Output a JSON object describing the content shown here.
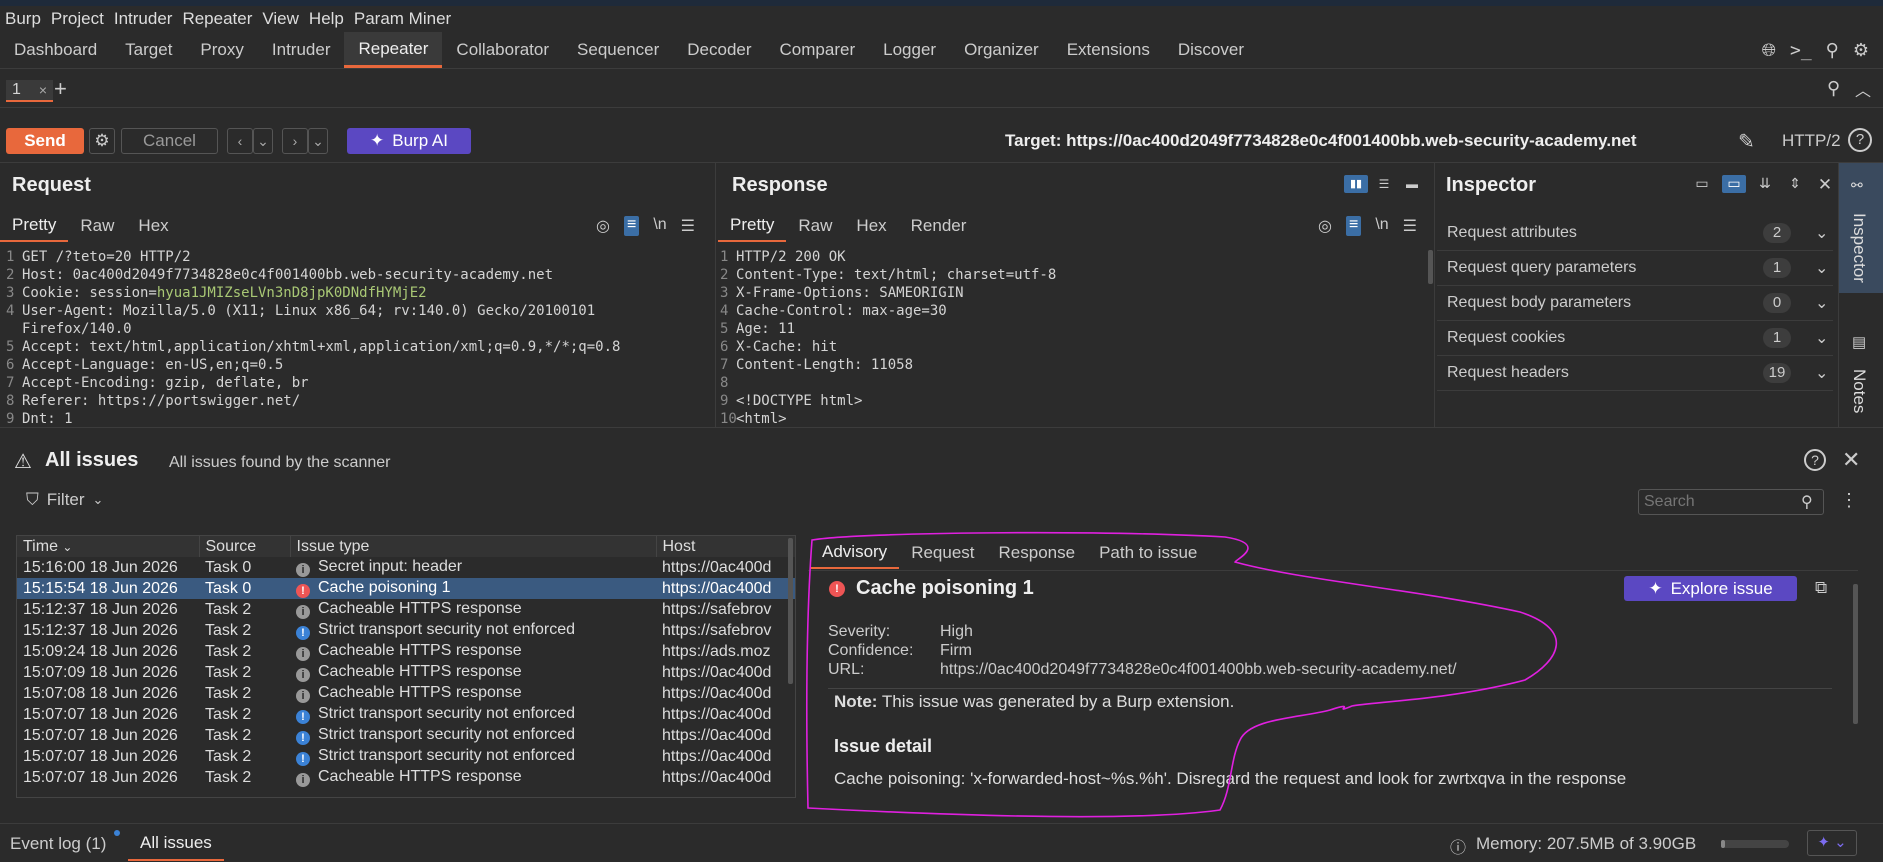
{
  "menu": [
    "Burp",
    "Project",
    "Intruder",
    "Repeater",
    "View",
    "Help",
    "Param Miner"
  ],
  "main_tabs": [
    "Dashboard",
    "Target",
    "Proxy",
    "Intruder",
    "Repeater",
    "Collaborator",
    "Sequencer",
    "Decoder",
    "Comparer",
    "Logger",
    "Organizer",
    "Extensions",
    "Discover"
  ],
  "active_main_tab": "Repeater",
  "repeater_tab": {
    "label": "1",
    "close": "×",
    "add": "+"
  },
  "toolbar": {
    "send": "Send",
    "cancel": "Cancel",
    "burp_ai": "Burp AI",
    "target_label": "Target:",
    "target_url": "https://0ac400d2049f7734828e0c4f001400bb.web-security-academy.net",
    "protocol": "HTTP/2"
  },
  "request": {
    "title": "Request",
    "tabs": [
      "Pretty",
      "Raw",
      "Hex"
    ],
    "newline_toggle": "\\n",
    "lines": [
      {
        "n": "1",
        "text": "GET /?teto=20 HTTP/2"
      },
      {
        "n": "2",
        "text": "Host: 0ac400d2049f7734828e0c4f001400bb.web-security-academy.net"
      },
      {
        "n": "3",
        "key": "Cookie: session=",
        "value": "hyua1JMIZseLVn3nD8jpK0DNdfHYMjE2"
      },
      {
        "n": "4",
        "text": "User-Agent: Mozilla/5.0 (X11; Linux x86_64; rv:140.0) Gecko/20100101"
      },
      {
        "n": "",
        "text": "Firefox/140.0"
      },
      {
        "n": "5",
        "text": "Accept: text/html,application/xhtml+xml,application/xml;q=0.9,*/*;q=0.8"
      },
      {
        "n": "6",
        "text": "Accept-Language: en-US,en;q=0.5"
      },
      {
        "n": "7",
        "text": "Accept-Encoding: gzip, deflate, br"
      },
      {
        "n": "8",
        "text": "Referer: https://portswigger.net/"
      },
      {
        "n": "9",
        "text": "Dnt: 1"
      }
    ]
  },
  "response": {
    "title": "Response",
    "tabs": [
      "Pretty",
      "Raw",
      "Hex",
      "Render"
    ],
    "newline_toggle": "\\n",
    "lines": [
      {
        "n": "1",
        "text": "HTTP/2 200 OK"
      },
      {
        "n": "2",
        "text": "Content-Type: text/html; charset=utf-8"
      },
      {
        "n": "3",
        "text": "X-Frame-Options: SAMEORIGIN"
      },
      {
        "n": "4",
        "text": "Cache-Control: max-age=30"
      },
      {
        "n": "5",
        "text": "Age: 11"
      },
      {
        "n": "6",
        "text": "X-Cache: hit"
      },
      {
        "n": "7",
        "text": "Content-Length: 11058"
      },
      {
        "n": "8",
        "text": ""
      },
      {
        "n": "9",
        "text": "<!DOCTYPE html>"
      },
      {
        "n": "10",
        "text": "<html>"
      }
    ]
  },
  "inspector": {
    "title": "Inspector",
    "rows": [
      {
        "label": "Request attributes",
        "count": "2"
      },
      {
        "label": "Request query parameters",
        "count": "1"
      },
      {
        "label": "Request body parameters",
        "count": "0"
      },
      {
        "label": "Request cookies",
        "count": "1"
      },
      {
        "label": "Request headers",
        "count": "19"
      }
    ]
  },
  "side_tabs": [
    "Inspector",
    "Notes"
  ],
  "issues": {
    "title": "All issues",
    "subtitle": "All issues found by the scanner",
    "filter": "Filter",
    "search_placeholder": "Search",
    "columns": [
      "Time",
      "Source",
      "Issue type",
      "Host"
    ],
    "rows": [
      {
        "time": "15:16:00 18 Jun 2026",
        "source": "Task 0",
        "severity": "info",
        "type": "Secret input: header",
        "host": "https://0ac400d"
      },
      {
        "time": "15:15:54 18 Jun 2026",
        "source": "Task 0",
        "severity": "high",
        "type": "Cache poisoning 1",
        "host": "https://0ac400d"
      },
      {
        "time": "15:12:37 18 Jun 2026",
        "source": "Task 2",
        "severity": "info",
        "type": "Cacheable HTTPS response",
        "host": "https://safebrov"
      },
      {
        "time": "15:12:37 18 Jun 2026",
        "source": "Task 2",
        "severity": "low",
        "type": "Strict transport security not enforced",
        "host": "https://safebrov"
      },
      {
        "time": "15:09:24 18 Jun 2026",
        "source": "Task 2",
        "severity": "info",
        "type": "Cacheable HTTPS response",
        "host": "https://ads.moz"
      },
      {
        "time": "15:07:09 18 Jun 2026",
        "source": "Task 2",
        "severity": "info",
        "type": "Cacheable HTTPS response",
        "host": "https://0ac400d"
      },
      {
        "time": "15:07:08 18 Jun 2026",
        "source": "Task 2",
        "severity": "info",
        "type": "Cacheable HTTPS response",
        "host": "https://0ac400d"
      },
      {
        "time": "15:07:07 18 Jun 2026",
        "source": "Task 2",
        "severity": "low",
        "type": "Strict transport security not enforced",
        "host": "https://0ac400d"
      },
      {
        "time": "15:07:07 18 Jun 2026",
        "source": "Task 2",
        "severity": "low",
        "type": "Strict transport security not enforced",
        "host": "https://0ac400d"
      },
      {
        "time": "15:07:07 18 Jun 2026",
        "source": "Task 2",
        "severity": "low",
        "type": "Strict transport security not enforced",
        "host": "https://0ac400d"
      },
      {
        "time": "15:07:07 18 Jun 2026",
        "source": "Task 2",
        "severity": "info",
        "type": "Cacheable HTTPS response",
        "host": "https://0ac400d"
      }
    ],
    "selected_index": 1
  },
  "advisory": {
    "tabs": [
      "Advisory",
      "Request",
      "Response",
      "Path to issue"
    ],
    "title": "Cache poisoning 1",
    "explore": "Explore issue",
    "severity_label": "Severity:",
    "severity": "High",
    "confidence_label": "Confidence:",
    "confidence": "Firm",
    "url_label": "URL:",
    "url": "https://0ac400d2049f7734828e0c4f001400bb.web-security-academy.net/",
    "note_label": "Note:",
    "note": "This issue was generated by a Burp extension.",
    "detail_heading": "Issue detail",
    "detail": "Cache poisoning: 'x-forwarded-host~%s.%h'. Disregard the request and look for zwrtxqva in the response"
  },
  "statusbar": {
    "event_log": "Event log (1)",
    "all_issues": "All issues",
    "memory": "Memory: 207.5MB of 3.90GB"
  },
  "colors": {
    "accent": "#e8683c",
    "ai": "#5b48c2",
    "selected_row": "#3a5a80",
    "annotation": "#e020e0"
  }
}
